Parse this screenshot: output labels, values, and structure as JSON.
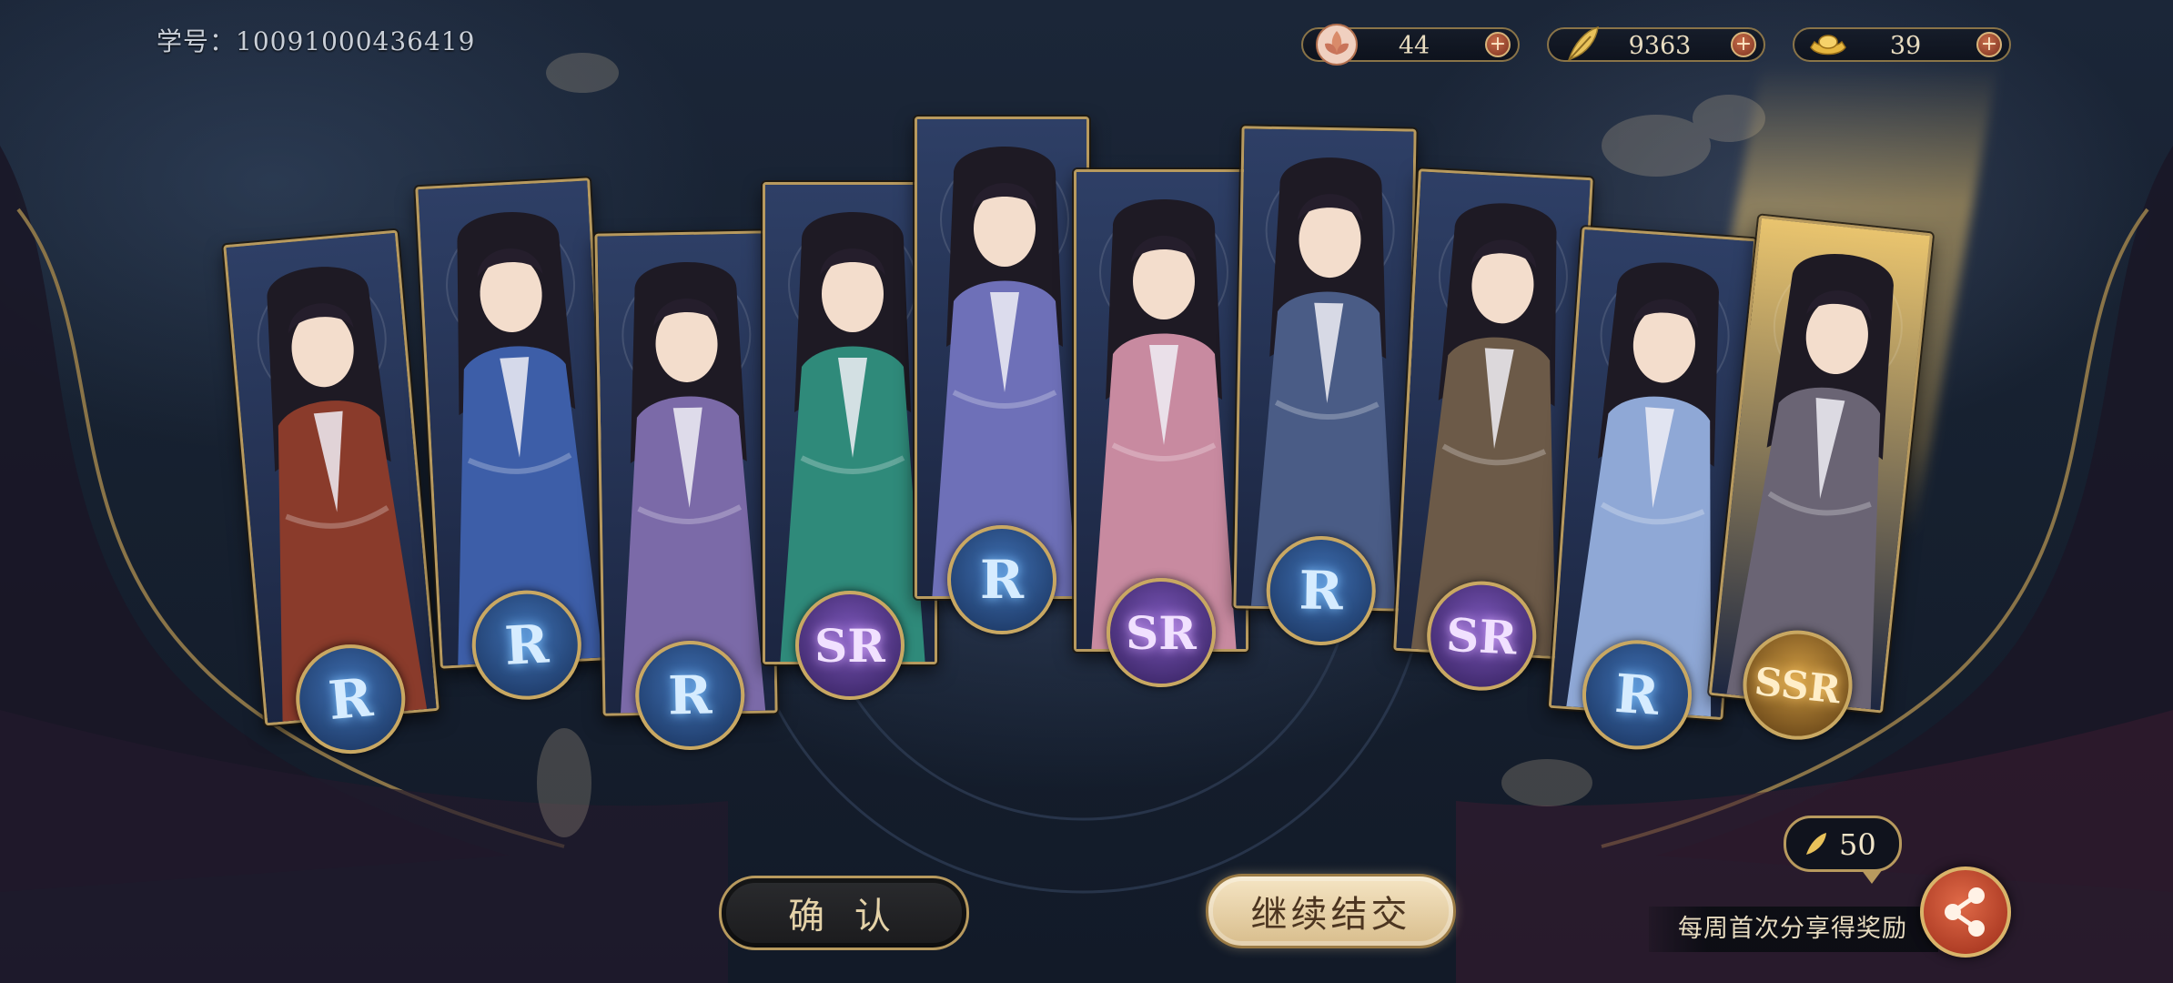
{
  "header": {
    "student_id": "学号：10091000436419"
  },
  "currencies": [
    {
      "name": "lotus-token",
      "value": "44",
      "icon": "lotus-icon",
      "color": "#d98b6a"
    },
    {
      "name": "feather",
      "value": "9363",
      "icon": "feather-icon",
      "color": "#e9c25a"
    },
    {
      "name": "gold-ingot",
      "value": "39",
      "icon": "gold-ingot-icon",
      "color": "#e6b740"
    }
  ],
  "cards": [
    {
      "rarity": "R",
      "theme": "#8a3b2b"
    },
    {
      "rarity": "R",
      "theme": "#3d5ea8"
    },
    {
      "rarity": "R",
      "theme": "#7b6aa8"
    },
    {
      "rarity": "SR",
      "theme": "#2f8a7a"
    },
    {
      "rarity": "R",
      "theme": "#6e70b8"
    },
    {
      "rarity": "SR",
      "theme": "#c88aa0"
    },
    {
      "rarity": "R",
      "theme": "#4a5c86"
    },
    {
      "rarity": "SR",
      "theme": "#6c5a48"
    },
    {
      "rarity": "R",
      "theme": "#8fa8d6"
    },
    {
      "rarity": "SSR",
      "theme": "#6a6474"
    }
  ],
  "buttons": {
    "confirm": "确 认",
    "continue": "继续结交"
  },
  "cost": {
    "value": "50",
    "icon": "feather-icon"
  },
  "share": {
    "label": "每周首次分享得奖励",
    "icon": "share-icon"
  }
}
